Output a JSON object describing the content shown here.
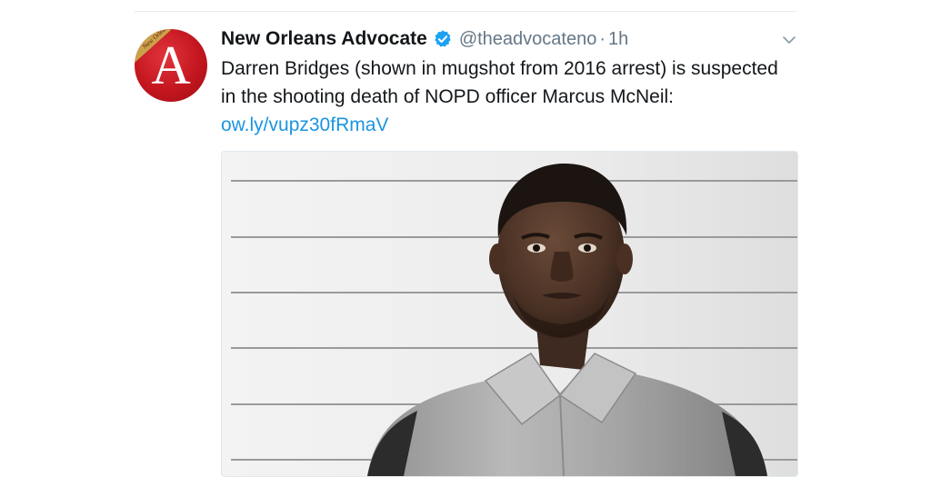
{
  "tweet": {
    "author": {
      "display_name": "New Orleans Advocate",
      "handle": "@theadvocateno",
      "verified": true,
      "avatar_icon": "new-orleans-advocate-logo",
      "avatar_letter": "A",
      "avatar_band_text": "New Orleans"
    },
    "separator": "·",
    "timestamp": "1h",
    "text_before_link": "Darren Bridges (shown in mugshot from 2016 arrest) is suspected in the shooting death of NOPD officer Marcus McNeil: ",
    "link_text": "ow.ly/vupz30fRmaV",
    "media": {
      "type": "photo",
      "icon": "mugshot-photo"
    },
    "menu_icon": "chevron-down-icon"
  },
  "colors": {
    "link": "#1b95e0",
    "secondary_text": "#657786",
    "verified_badge": "#1da1f2",
    "avatar_red": "#c4161f",
    "avatar_band_gold": "#c9a34a"
  }
}
